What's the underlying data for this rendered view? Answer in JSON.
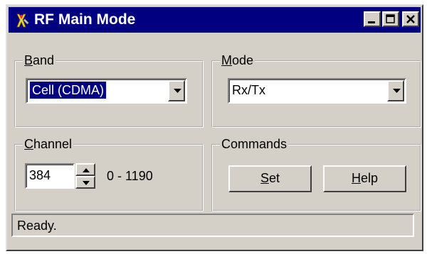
{
  "window": {
    "title": "RF Main Mode",
    "icon": "antenna-wrench-icon"
  },
  "caption_buttons": {
    "minimize": "minimize-icon",
    "maximize": "maximize-icon",
    "close": "close-icon"
  },
  "band": {
    "label_pre": "",
    "label_mnemonic": "B",
    "label_post": "and",
    "value": "Cell (CDMA)"
  },
  "mode": {
    "label_pre": "",
    "label_mnemonic": "M",
    "label_post": "ode",
    "value": "Rx/Tx"
  },
  "channel": {
    "label_pre": "",
    "label_mnemonic": "C",
    "label_post": "hannel",
    "value": "384",
    "range": "0 - 1190"
  },
  "commands": {
    "label": "Commands",
    "set_pre": "",
    "set_mnemonic": "S",
    "set_post": "et",
    "help_pre": "",
    "help_mnemonic": "H",
    "help_post": "elp"
  },
  "status": {
    "text": "Ready."
  },
  "colors": {
    "titlebar": "#000080",
    "face": "#d4d0c8",
    "selection": "#000080"
  }
}
